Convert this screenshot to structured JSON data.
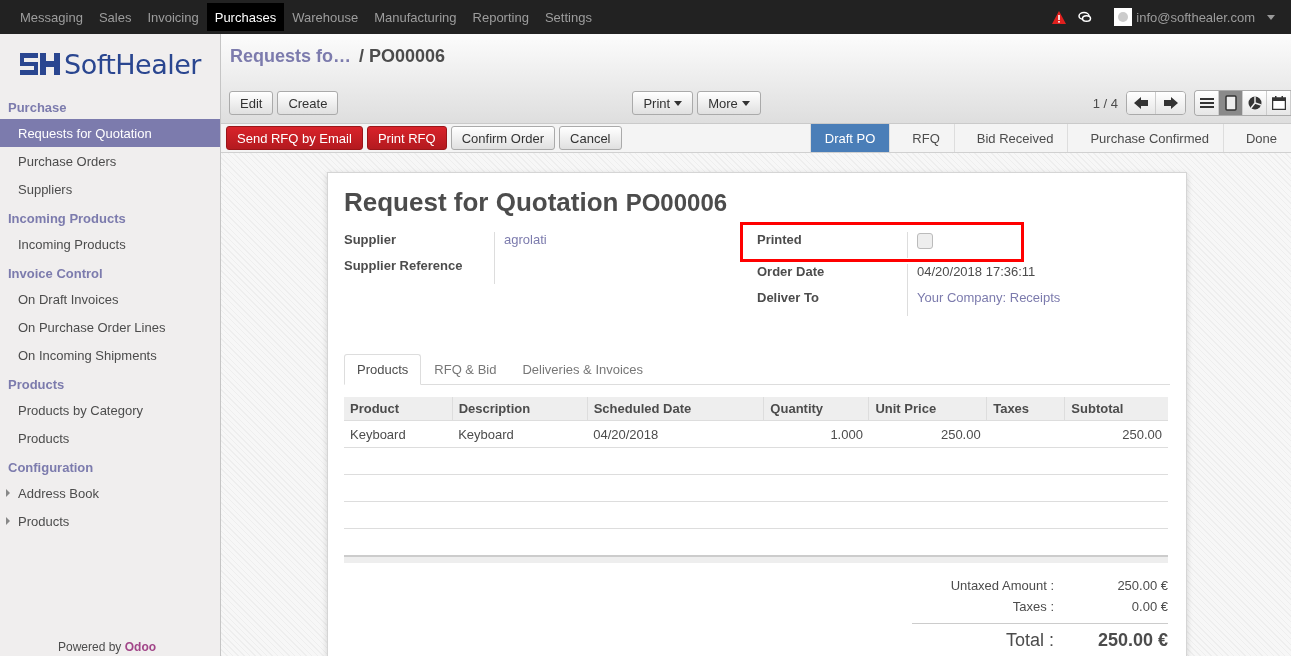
{
  "top_menu": [
    {
      "label": "Messaging",
      "selected": false
    },
    {
      "label": "Sales",
      "selected": false
    },
    {
      "label": "Invoicing",
      "selected": false
    },
    {
      "label": "Purchases",
      "selected": true
    },
    {
      "label": "Warehouse",
      "selected": false
    },
    {
      "label": "Manufacturing",
      "selected": false
    },
    {
      "label": "Reporting",
      "selected": false
    },
    {
      "label": "Settings",
      "selected": false
    }
  ],
  "user": {
    "email": "info@softhealer.com"
  },
  "logo": {
    "text": "SoftHealer"
  },
  "sidebar": {
    "sections": [
      {
        "title": "Purchase",
        "items": [
          {
            "label": "Requests for Quotation",
            "selected": true,
            "expandable": false
          },
          {
            "label": "Purchase Orders",
            "selected": false,
            "expandable": false
          },
          {
            "label": "Suppliers",
            "selected": false,
            "expandable": false
          }
        ]
      },
      {
        "title": "Incoming Products",
        "items": [
          {
            "label": "Incoming Products",
            "selected": false,
            "expandable": false
          }
        ]
      },
      {
        "title": "Invoice Control",
        "items": [
          {
            "label": "On Draft Invoices",
            "selected": false,
            "expandable": false
          },
          {
            "label": "On Purchase Order Lines",
            "selected": false,
            "expandable": false
          },
          {
            "label": "On Incoming Shipments",
            "selected": false,
            "expandable": false
          }
        ]
      },
      {
        "title": "Products",
        "items": [
          {
            "label": "Products by Category",
            "selected": false,
            "expandable": false
          },
          {
            "label": "Products",
            "selected": false,
            "expandable": false
          }
        ]
      },
      {
        "title": "Configuration",
        "items": [
          {
            "label": "Address Book",
            "selected": false,
            "expandable": true
          },
          {
            "label": "Products",
            "selected": false,
            "expandable": true
          }
        ]
      }
    ],
    "footer": {
      "prefix": "Powered by",
      "brand": "Odoo"
    }
  },
  "breadcrumb": {
    "parent": "Requests fo…",
    "current": "/ PO00006"
  },
  "actions": [
    "Edit",
    "Create"
  ],
  "dropdowns": [
    "Print",
    "More"
  ],
  "pager": "1 / 4",
  "views": [
    {
      "kind": "list",
      "selected": false
    },
    {
      "kind": "form",
      "selected": true
    },
    {
      "kind": "graph",
      "selected": false
    },
    {
      "kind": "calendar",
      "selected": false
    }
  ],
  "workflow_buttons": [
    {
      "label": "Send RFQ by Email",
      "kind": "primary"
    },
    {
      "label": "Print RFQ",
      "kind": "primary"
    },
    {
      "label": "Confirm Order",
      "kind": "default"
    },
    {
      "label": "Cancel",
      "kind": "default"
    }
  ],
  "stages": [
    {
      "label": "Draft PO",
      "selected": true
    },
    {
      "label": "RFQ",
      "selected": false
    },
    {
      "label": "Bid Received",
      "selected": false
    },
    {
      "label": "Purchase Confirmed",
      "selected": false
    },
    {
      "label": "Done",
      "selected": false
    }
  ],
  "form": {
    "title": "Request for Quotation",
    "number": "PO00006",
    "left_fields": [
      {
        "label": "Supplier",
        "value": "agrolati",
        "kind": "link"
      },
      {
        "label": "Supplier Reference",
        "kind": "text"
      }
    ],
    "right_fields": [
      {
        "label": "Printed",
        "kind": "checkbox",
        "checked": false,
        "highlighted": true
      },
      {
        "label": "Order Date",
        "value": "04/20/2018 17:36:11",
        "kind": "text",
        "highlighted": false
      },
      {
        "label": "Deliver To",
        "value": "Your Company: Receipts",
        "kind": "link",
        "highlighted": false
      }
    ],
    "tabs": [
      {
        "label": "Products",
        "selected": true
      },
      {
        "label": "RFQ & Bid",
        "selected": false
      },
      {
        "label": "Deliveries & Invoices",
        "selected": false
      }
    ],
    "table": {
      "columns": [
        "Product",
        "Description",
        "Scheduled Date",
        "Quantity",
        "Unit Price",
        "Taxes",
        "Subtotal"
      ],
      "rows": [
        [
          "Keyboard",
          "Keyboard",
          "04/20/2018",
          "1.000",
          "250.00",
          "",
          "250.00"
        ]
      ]
    },
    "totals": [
      {
        "label": "Untaxed Amount :",
        "value": "250.00 €",
        "kind": "normal"
      },
      {
        "label": "Taxes :",
        "value": "0.00 €",
        "kind": "normal"
      },
      {
        "label": "Total :",
        "value": "250.00 €",
        "kind": "grand"
      }
    ]
  }
}
